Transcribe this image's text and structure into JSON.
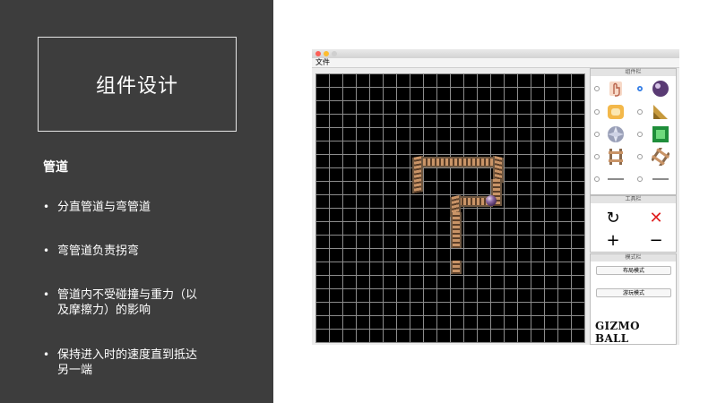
{
  "slide": {
    "title": "组件设计",
    "heading": "管道",
    "bullets": [
      {
        "line1": "分直管道与弯管道",
        "line2": ""
      },
      {
        "line1": "弯管道负责拐弯",
        "line2": ""
      },
      {
        "line1": "管道内不受碰撞与重力（以",
        "line2": "及摩擦力）的影响"
      },
      {
        "line1": "保持进入时的速度直到抵达",
        "line2": "另一端"
      }
    ],
    "bullet_symbol": "•"
  },
  "app": {
    "menu_file": "文件",
    "component_bar_title": "组件栏",
    "tool_bar_title": "工具栏",
    "mode_bar_title": "模式栏",
    "components": [
      {
        "name": "hand-icon",
        "selected": false
      },
      {
        "name": "ball-icon",
        "selected": true
      },
      {
        "name": "absorber-icon",
        "selected": false
      },
      {
        "name": "triangle-icon",
        "selected": false
      },
      {
        "name": "circle-gem-icon",
        "selected": false
      },
      {
        "name": "square-gem-icon",
        "selected": false
      },
      {
        "name": "straight-pipe-icon",
        "selected": false
      },
      {
        "name": "curved-pipe-icon",
        "selected": false
      },
      {
        "name": "left-flipper-icon",
        "selected": false
      },
      {
        "name": "right-flipper-icon",
        "selected": false
      }
    ],
    "tools": {
      "rotate": "↻",
      "delete": "✕",
      "zoom_in": "+",
      "zoom_out": "−"
    },
    "layout_mode_label": "布局模式",
    "play_mode_label": "游玩模式",
    "logo_text": "GIZMO BALL",
    "colors": {
      "board_bg": "#000000",
      "grid": "#8c8c8c",
      "delete": "#e02020",
      "radio_on": "#2f7ae5"
    }
  }
}
